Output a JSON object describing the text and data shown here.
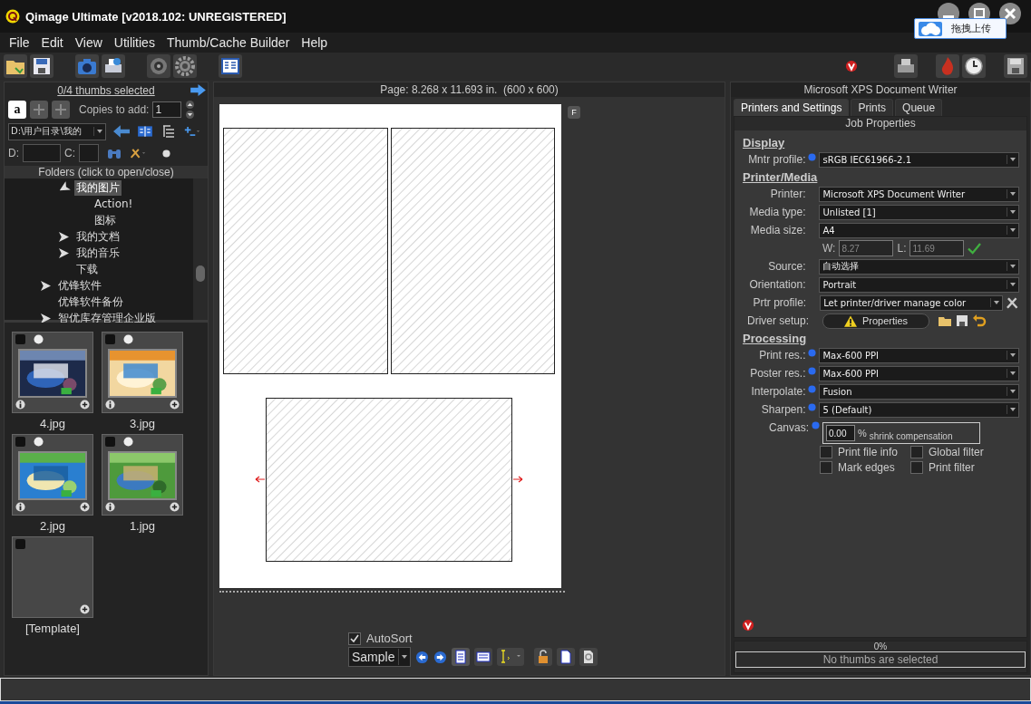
{
  "window": {
    "title": "Qimage Ultimate [v2018.102: UNREGISTERED]"
  },
  "upload_widget": {
    "label": "拖拽上传"
  },
  "menu": [
    "File",
    "Edit",
    "View",
    "Utilities",
    "Thumb/Cache Builder",
    "Help"
  ],
  "left_panel": {
    "selection_link": "0/4 thumbs selected",
    "font_button": "a",
    "copies_label": "Copies to add:",
    "copies_value": "1",
    "path": "D:\\用户目录\\我的",
    "d_label": "D:",
    "c_label": "C:",
    "folders_header": "Folders (click to open/close)",
    "folder_tree": [
      {
        "children": [
          {
            "label": "我的图片",
            "expanded": true,
            "selected": true,
            "children": [
              {
                "label": "Action!",
                "selected": false
              },
              {
                "label": "图标",
                "selected": false
              }
            ]
          },
          {
            "label": "我的文档",
            "expanded": false,
            "selected": false
          },
          {
            "label": "我的音乐",
            "expanded": false,
            "selected": false
          },
          {
            "label": "下载",
            "selected": false
          }
        ]
      },
      {
        "label": "优锋软件",
        "expanded": false,
        "selected": false
      },
      {
        "label": "优锋软件备份",
        "selected": false
      },
      {
        "label": "智优库存管理企业版",
        "expanded": false,
        "selected": false
      }
    ],
    "thumbs": [
      {
        "kind": "picture",
        "name": "4.jpg",
        "checked": false
      },
      {
        "kind": "picture",
        "name": "3.jpg",
        "checked": false
      },
      {
        "kind": "picture",
        "name": "2.jpg",
        "checked": false
      },
      {
        "kind": "picture",
        "name": "1.jpg",
        "checked": false
      },
      {
        "kind": "template",
        "name": "[Template]",
        "checked": false
      }
    ]
  },
  "center": {
    "page_info": "Page: 8.268 x 11.693 in.  (600 x 600)",
    "frame_button": "F",
    "autosort": {
      "label": "AutoSort",
      "checked": true
    },
    "sort_select": "Sample"
  },
  "right_panel": {
    "printer": "Microsoft XPS Document Writer",
    "tabs": [
      {
        "label": "Printers and Settings",
        "selected": true
      },
      {
        "label": "Prints",
        "selected": false
      },
      {
        "label": "Queue",
        "selected": false
      }
    ],
    "group_title": "Job Properties",
    "sections": [
      {
        "title": "Display",
        "rows": [
          {
            "kind": "select",
            "label": "Mntr profile:",
            "dot": true,
            "value": "sRGB IEC61966-2.1"
          }
        ]
      },
      {
        "title": "Printer/Media",
        "rows": [
          {
            "kind": "select",
            "label": "Printer:",
            "dot": false,
            "value": "Microsoft XPS Document Writer"
          },
          {
            "kind": "select",
            "label": "Media type:",
            "dot": false,
            "value": "Unlisted [1]"
          },
          {
            "kind": "select",
            "label": "Media size:",
            "dot": false,
            "value": "A4"
          },
          {
            "kind": "size",
            "w_label": "W:",
            "w": "8.27",
            "l_label": "L:",
            "l": "11.69"
          },
          {
            "kind": "select",
            "label": "Source:",
            "dot": false,
            "value": "自动选择"
          },
          {
            "kind": "select",
            "label": "Orientation:",
            "dot": false,
            "value": "Portrait"
          },
          {
            "kind": "select-tool",
            "label": "Prtr profile:",
            "dot": false,
            "value": "Let printer/driver manage color"
          },
          {
            "kind": "button",
            "label": "Driver setup:",
            "dot": false,
            "value": "Properties"
          }
        ]
      },
      {
        "title": "Processing",
        "rows": [
          {
            "kind": "select",
            "label": "Print res.:",
            "dot": true,
            "value": "Max-600 PPI"
          },
          {
            "kind": "select",
            "label": "Poster res.:",
            "dot": true,
            "value": "Max-600 PPI"
          },
          {
            "kind": "select",
            "label": "Interpolate:",
            "dot": true,
            "value": "Fusion"
          },
          {
            "kind": "select",
            "label": "Sharpen:",
            "dot": true,
            "value": "5 (Default)"
          },
          {
            "kind": "canvas",
            "label": "Canvas:",
            "dot": true,
            "value": "0.00",
            "unit": "%",
            "note": "shrink compensation"
          }
        ]
      }
    ],
    "options": [
      {
        "label": "Print file info",
        "checked": false
      },
      {
        "label": "Global filter",
        "checked": false
      },
      {
        "label": "Mark edges",
        "checked": false
      },
      {
        "label": "Print filter",
        "checked": false
      }
    ],
    "progress_label": "0%",
    "status": "No thumbs are selected"
  }
}
